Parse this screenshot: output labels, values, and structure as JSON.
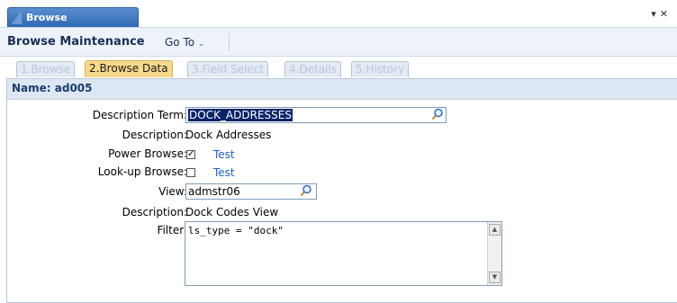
{
  "app_tab": {
    "label": "Browse Maintenance"
  },
  "header": {
    "title": "Browse Maintenance",
    "goto_label": "Go To"
  },
  "subtabs": [
    {
      "label": "1.Browse"
    },
    {
      "label": "2.Browse Data"
    },
    {
      "label": "3.Field Select"
    },
    {
      "label": "4.Details"
    },
    {
      "label": "5.History"
    }
  ],
  "panel": {
    "name_label": "Name: ad005"
  },
  "form": {
    "description_term_label": "Description Term:",
    "description_term_value": "DOCK_ADDRESSES",
    "description_label": "Description:",
    "description_value": "Dock Addresses",
    "power_browse_label": "Power Browse:",
    "power_browse_checked": true,
    "power_browse_link": "Test",
    "lookup_browse_label": "Look-up Browse:",
    "lookup_browse_checked": false,
    "lookup_browse_link": "Test",
    "view_label": "View:",
    "view_value": "admstr06",
    "view_description_label": "Description:",
    "view_description_value": "Dock Codes View",
    "filter_label": "Filter:",
    "filter_value": "ls_type = \"dock\""
  },
  "icons": {
    "search": "magnifier-icon",
    "dropdown": "chevron-down-icon",
    "close": "close-icon"
  },
  "colors": {
    "tab_blue": "#2f68b3",
    "active_subtab": "#f6d98a",
    "link": "#1f5fd0",
    "header_text": "#1a2f5a"
  }
}
